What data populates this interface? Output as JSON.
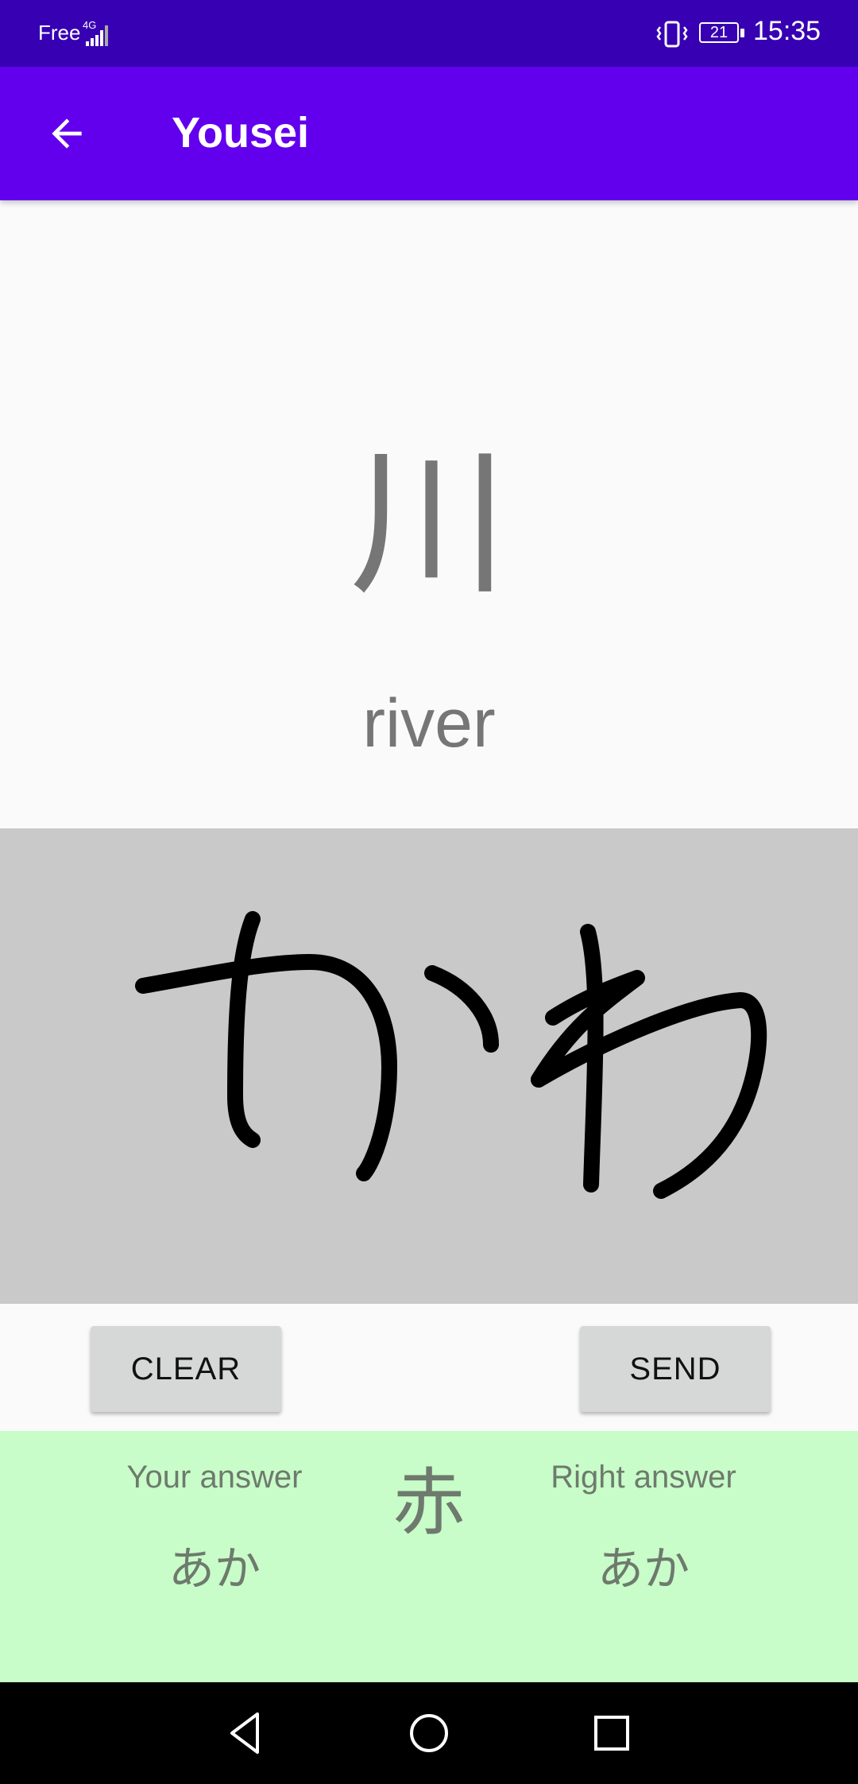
{
  "status_bar": {
    "carrier": "Free",
    "network_type": "4G",
    "battery": "21",
    "time": "15:35",
    "icons": [
      "signal-icon",
      "vibrate-icon",
      "battery-icon"
    ]
  },
  "app_bar": {
    "title": "Yousei",
    "back_icon": "arrow-back-icon"
  },
  "card": {
    "kanji": "川",
    "meaning": "river"
  },
  "canvas": {
    "drawn_text": "かわ"
  },
  "buttons": {
    "clear_label": "CLEAR",
    "send_label": "SEND"
  },
  "result": {
    "your_answer_label": "Your answer",
    "your_answer_value": "あか",
    "kanji": "赤",
    "right_answer_label": "Right answer",
    "right_answer_value": "あか"
  },
  "colors": {
    "status_bar": "#3700b3",
    "app_bar": "#6200ee",
    "canvas": "#c9c9c9",
    "result_panel": "#c8fcc8"
  },
  "nav_bar": {
    "icons": [
      "nav-back-icon",
      "nav-home-icon",
      "nav-recents-icon"
    ]
  }
}
